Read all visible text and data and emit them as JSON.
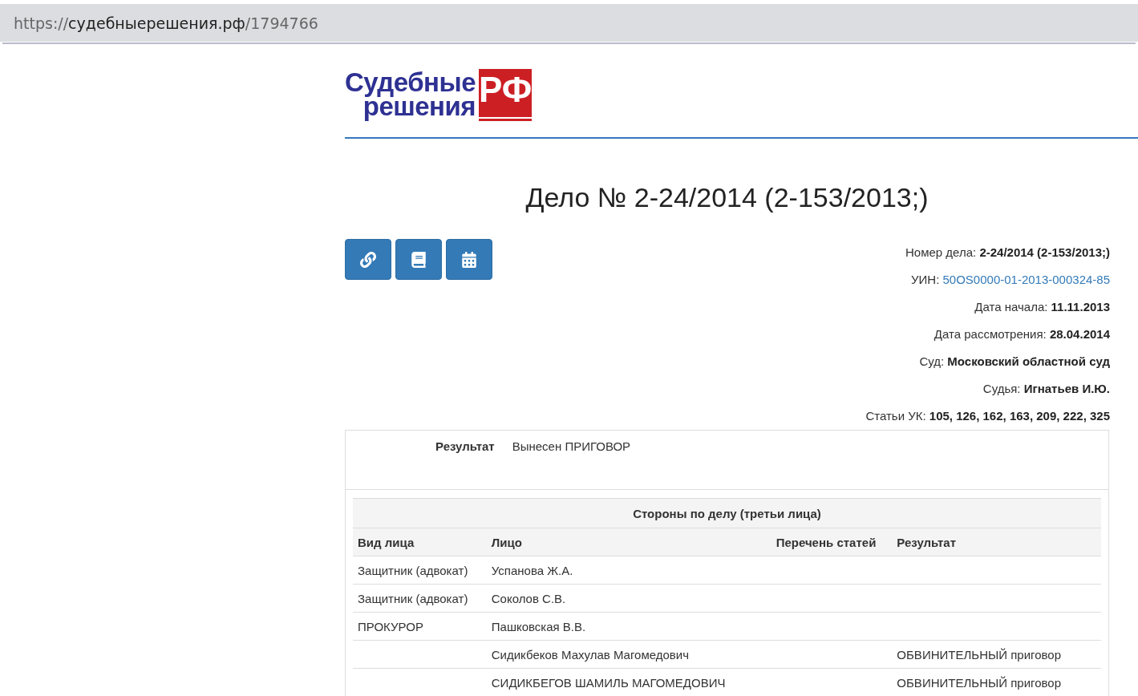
{
  "address_bar": {
    "scheme": "https://",
    "host": "судебныерешения.рф",
    "path": "/1794766"
  },
  "logo": {
    "line_1": "Судебные",
    "line_2": "решения",
    "badge": "РФ"
  },
  "title": "Дело № 2-24/2014 (2-153/2013;)",
  "toolbar": [
    {
      "kind": "link"
    },
    {
      "kind": "book"
    },
    {
      "kind": "calendar"
    }
  ],
  "details": [
    {
      "label": "Номер дела:",
      "value": "2-24/2014 (2-153/2013;)",
      "kind": "text"
    },
    {
      "label": "УИН:",
      "value": "50OS0000-01-2013-000324-85",
      "kind": "link"
    },
    {
      "label": "Дата начала:",
      "value": "11.11.2013",
      "kind": "text"
    },
    {
      "label": "Дата рассмотрения:",
      "value": "28.04.2014",
      "kind": "text"
    },
    {
      "label": "Суд:",
      "value": "Московский областной суд",
      "kind": "text"
    },
    {
      "label": "Судья:",
      "value": "Игнатьев И.Ю.",
      "kind": "text"
    },
    {
      "label": "Статьи УК:",
      "value": "105, 126, 162, 163, 209, 222, 325",
      "kind": "text"
    }
  ],
  "result": {
    "label": "Результат",
    "value": "Вынесен ПРИГОВОР"
  },
  "parties_table": {
    "caption": "Стороны по делу (третьи лица)",
    "columns": [
      "Вид лица",
      "Лицо",
      "Перечень статей",
      "Результат"
    ],
    "rows": [
      [
        "Защитник (адвокат)",
        "Успанова Ж.А.",
        "",
        ""
      ],
      [
        "Защитник (адвокат)",
        "Соколов С.В.",
        "",
        ""
      ],
      [
        "ПРОКУРОР",
        "Пашковская В.В.",
        "",
        ""
      ],
      [
        "",
        "Сидикбеков Махулав Магомедович",
        "",
        "ОБВИНИТЕЛЬНЫЙ приговор"
      ],
      [
        "",
        "СИДИКБЕГОВ ШАМИЛЬ МАГОМЕДОВИЧ",
        "",
        "ОБВИНИТЕЛЬНЫЙ приговор"
      ]
    ]
  }
}
